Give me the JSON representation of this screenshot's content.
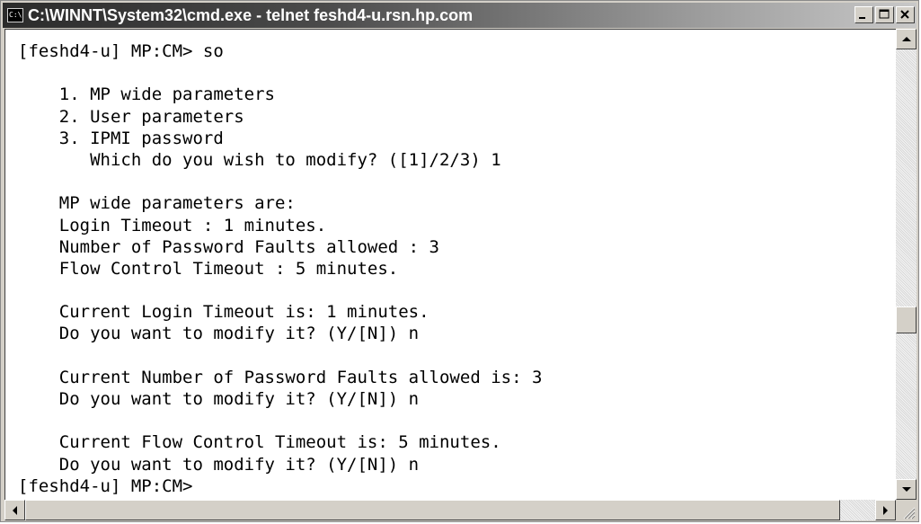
{
  "window": {
    "title": "C:\\WINNT\\System32\\cmd.exe - telnet feshd4-u.rsn.hp.com",
    "icon_text": "C:\\"
  },
  "console": {
    "lines": [
      "[feshd4-u] MP:CM> so",
      "",
      "    1. MP wide parameters",
      "    2. User parameters",
      "    3. IPMI password",
      "       Which do you wish to modify? ([1]/2/3) 1",
      "",
      "    MP wide parameters are:",
      "    Login Timeout : 1 minutes.",
      "    Number of Password Faults allowed : 3",
      "    Flow Control Timeout : 5 minutes.",
      "",
      "    Current Login Timeout is: 1 minutes.",
      "    Do you want to modify it? (Y/[N]) n",
      "",
      "    Current Number of Password Faults allowed is: 3",
      "    Do you want to modify it? (Y/[N]) n",
      "",
      "    Current Flow Control Timeout is: 5 minutes.",
      "    Do you want to modify it? (Y/[N]) n",
      "[feshd4-u] MP:CM>"
    ]
  },
  "icons": {
    "minimize": "minimize-icon",
    "maximize": "maximize-icon",
    "close": "close-icon",
    "scroll_up": "scroll-up-arrow-icon",
    "scroll_down": "scroll-down-arrow-icon",
    "scroll_left": "scroll-left-arrow-icon",
    "scroll_right": "scroll-right-arrow-icon",
    "resize": "resize-grip-icon"
  },
  "colors": {
    "title_start": "#2b2b2b",
    "title_end": "#c8c8c8",
    "console_bg": "#ffffff",
    "console_fg": "#000000",
    "chrome": "#d4d0c8"
  }
}
